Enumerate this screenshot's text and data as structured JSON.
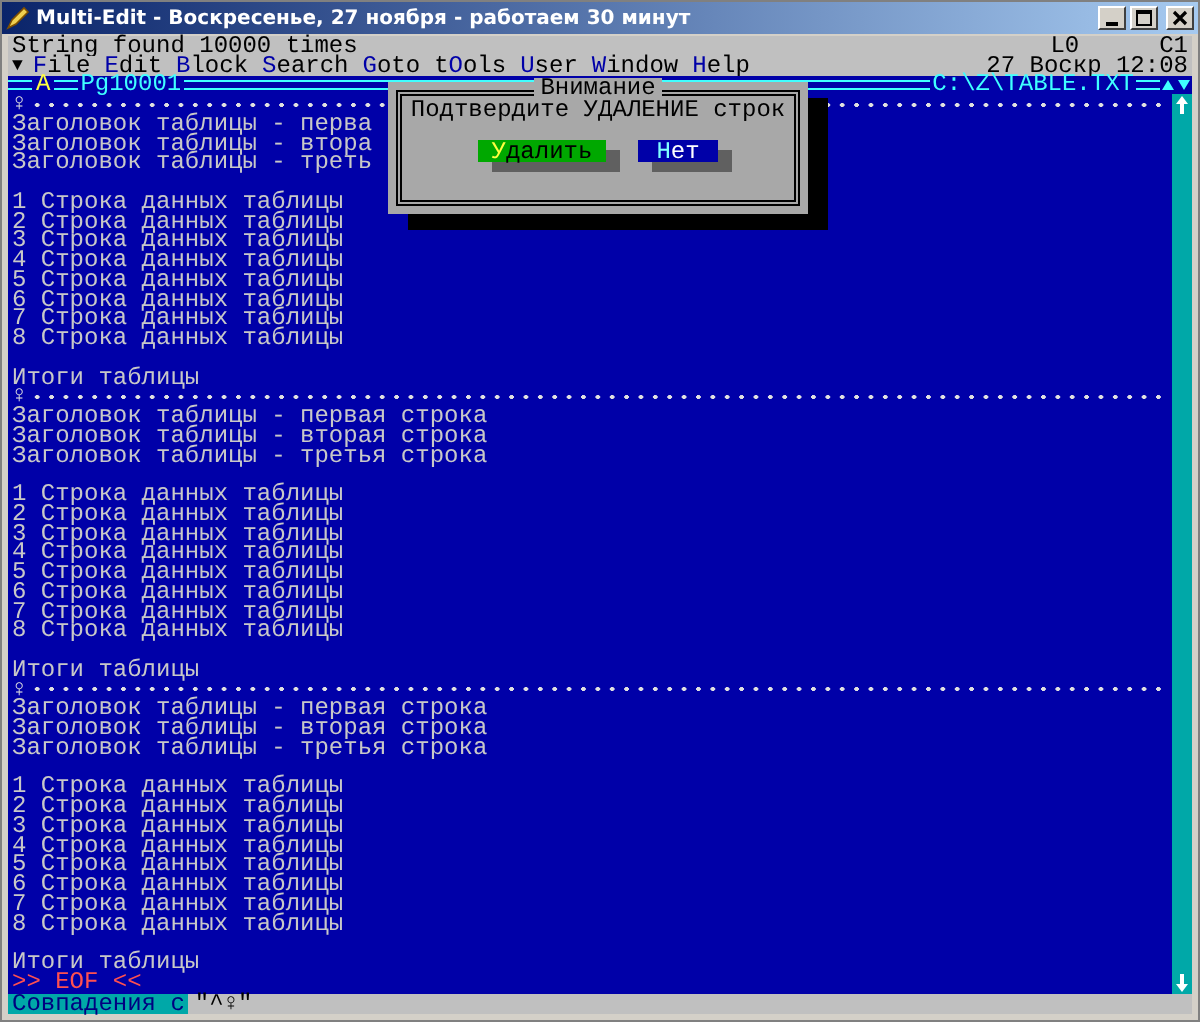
{
  "window": {
    "title": "Multi-Edit - Воскресенье, 27 ноября - работаем 30 минут"
  },
  "status_line": {
    "message": "String found 10000 times",
    "line": "L0",
    "column": "C1"
  },
  "menu": {
    "arrow": "▼",
    "items": [
      {
        "key": "F",
        "after": "ile"
      },
      {
        "key": "E",
        "after": "dit"
      },
      {
        "key": "B",
        "after": "lock"
      },
      {
        "key": "S",
        "after": "earch"
      },
      {
        "key": "G",
        "after": "oto"
      },
      {
        "before": "t",
        "key": "O",
        "after": "ols"
      },
      {
        "key": "U",
        "after": "ser"
      },
      {
        "key": "W",
        "after": "indow"
      },
      {
        "key": "H",
        "after": "elp"
      }
    ],
    "clock": "27 Воскр 12:08"
  },
  "editor": {
    "mode": "A",
    "page": "Pg10001",
    "file": "C:\\Z\\TABLE.TXT",
    "lines": [
      {
        "kind": "break",
        "text": "♀"
      },
      {
        "kind": "text",
        "text": "Заголовок таблицы - перва"
      },
      {
        "kind": "text",
        "text": "Заголовок таблицы - втора"
      },
      {
        "kind": "text",
        "text": "Заголовок таблицы - треть"
      },
      {
        "kind": "blank"
      },
      {
        "kind": "text",
        "text": "1 Строка данных таблицы"
      },
      {
        "kind": "text",
        "text": "2 Строка данных таблицы"
      },
      {
        "kind": "text",
        "text": "3 Строка данных таблицы"
      },
      {
        "kind": "text",
        "text": "4 Строка данных таблицы"
      },
      {
        "kind": "text",
        "text": "5 Строка данных таблицы"
      },
      {
        "kind": "text",
        "text": "6 Строка данных таблицы"
      },
      {
        "kind": "text",
        "text": "7 Строка данных таблицы"
      },
      {
        "kind": "text",
        "text": "8 Строка данных таблицы"
      },
      {
        "kind": "blank"
      },
      {
        "kind": "text",
        "text": "Итоги таблицы"
      },
      {
        "kind": "break",
        "text": "♀"
      },
      {
        "kind": "text",
        "text": "Заголовок таблицы - первая строка"
      },
      {
        "kind": "text",
        "text": "Заголовок таблицы - вторая строка"
      },
      {
        "kind": "text",
        "text": "Заголовок таблицы - третья строка"
      },
      {
        "kind": "blank"
      },
      {
        "kind": "text",
        "text": "1 Строка данных таблицы"
      },
      {
        "kind": "text",
        "text": "2 Строка данных таблицы"
      },
      {
        "kind": "text",
        "text": "3 Строка данных таблицы"
      },
      {
        "kind": "text",
        "text": "4 Строка данных таблицы"
      },
      {
        "kind": "text",
        "text": "5 Строка данных таблицы"
      },
      {
        "kind": "text",
        "text": "6 Строка данных таблицы"
      },
      {
        "kind": "text",
        "text": "7 Строка данных таблицы"
      },
      {
        "kind": "text",
        "text": "8 Строка данных таблицы"
      },
      {
        "kind": "blank"
      },
      {
        "kind": "text",
        "text": "Итоги таблицы"
      },
      {
        "kind": "break",
        "text": "♀"
      },
      {
        "kind": "text",
        "text": "Заголовок таблицы - первая строка"
      },
      {
        "kind": "text",
        "text": "Заголовок таблицы - вторая строка"
      },
      {
        "kind": "text",
        "text": "Заголовок таблицы - третья строка"
      },
      {
        "kind": "blank"
      },
      {
        "kind": "text",
        "text": "1 Строка данных таблицы"
      },
      {
        "kind": "text",
        "text": "2 Строка данных таблицы"
      },
      {
        "kind": "text",
        "text": "3 Строка данных таблицы"
      },
      {
        "kind": "text",
        "text": "4 Строка данных таблицы"
      },
      {
        "kind": "text",
        "text": "5 Строка данных таблицы"
      },
      {
        "kind": "text",
        "text": "6 Строка данных таблицы"
      },
      {
        "kind": "text",
        "text": "7 Строка данных таблицы"
      },
      {
        "kind": "text",
        "text": "8 Строка данных таблицы"
      },
      {
        "kind": "blank"
      },
      {
        "kind": "text",
        "text": "Итоги таблицы"
      },
      {
        "kind": "eof",
        "text": ">> EOF <<"
      }
    ]
  },
  "dialog": {
    "title": "Внимание",
    "message": "Подтвердите УДАЛЕНИЕ строк",
    "buttons": [
      {
        "key": "У",
        "after": "далить",
        "selected": true
      },
      {
        "key": "Н",
        "after": "ет",
        "selected": false
      }
    ]
  },
  "prompt": {
    "label": "Совпадения с",
    "value": "\"^♀\""
  }
}
